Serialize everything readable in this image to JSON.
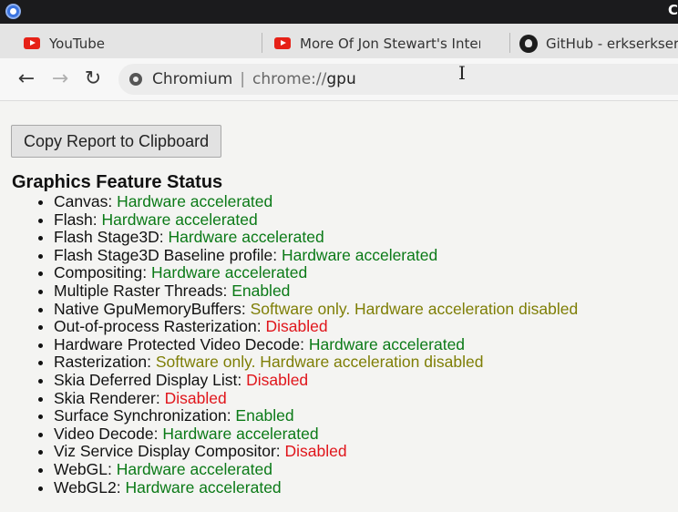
{
  "browser": {
    "corner_label": "C",
    "tabs": [
      {
        "title": "YouTube",
        "icon": "youtube-icon"
      },
      {
        "title": "More Of Jon Stewart's Inter",
        "icon": "youtube-icon"
      },
      {
        "title": "GitHub - erkserkser",
        "icon": "github-icon"
      }
    ],
    "omnibox": {
      "site_name": "Chromium",
      "separator": "|",
      "url_scheme": "chrome://",
      "url_host": "gpu"
    }
  },
  "page": {
    "copy_button_label": "Copy Report to Clipboard",
    "section_title": "Graphics Feature Status",
    "features": [
      {
        "name": "Canvas: ",
        "status": "Hardware accelerated",
        "state": "ok"
      },
      {
        "name": "Flash: ",
        "status": "Hardware accelerated",
        "state": "ok"
      },
      {
        "name": "Flash Stage3D: ",
        "status": "Hardware accelerated",
        "state": "ok"
      },
      {
        "name": "Flash Stage3D Baseline profile: ",
        "status": "Hardware accelerated",
        "state": "ok"
      },
      {
        "name": "Compositing: ",
        "status": "Hardware accelerated",
        "state": "ok"
      },
      {
        "name": "Multiple Raster Threads: ",
        "status": "Enabled",
        "state": "ok"
      },
      {
        "name": "Native GpuMemoryBuffers: ",
        "status": "Software only. Hardware acceleration disabled",
        "state": "partial"
      },
      {
        "name": "Out-of-process Rasterization: ",
        "status": "Disabled",
        "state": "off"
      },
      {
        "name": "Hardware Protected Video Decode: ",
        "status": "Hardware accelerated",
        "state": "ok"
      },
      {
        "name": "Rasterization: ",
        "status": "Software only. Hardware acceleration disabled",
        "state": "partial"
      },
      {
        "name": "Skia Deferred Display List: ",
        "status": "Disabled",
        "state": "off"
      },
      {
        "name": "Skia Renderer: ",
        "status": "Disabled",
        "state": "off"
      },
      {
        "name": "Surface Synchronization: ",
        "status": "Enabled",
        "state": "ok"
      },
      {
        "name": "Video Decode: ",
        "status": "Hardware accelerated",
        "state": "ok"
      },
      {
        "name": "Viz Service Display Compositor: ",
        "status": "Disabled",
        "state": "off"
      },
      {
        "name": "WebGL: ",
        "status": "Hardware accelerated",
        "state": "ok"
      },
      {
        "name": "WebGL2: ",
        "status": "Hardware accelerated",
        "state": "ok"
      }
    ]
  },
  "colors": {
    "ok": "#0b7a17",
    "partial": "#7e7e05",
    "off": "#e0151b"
  }
}
